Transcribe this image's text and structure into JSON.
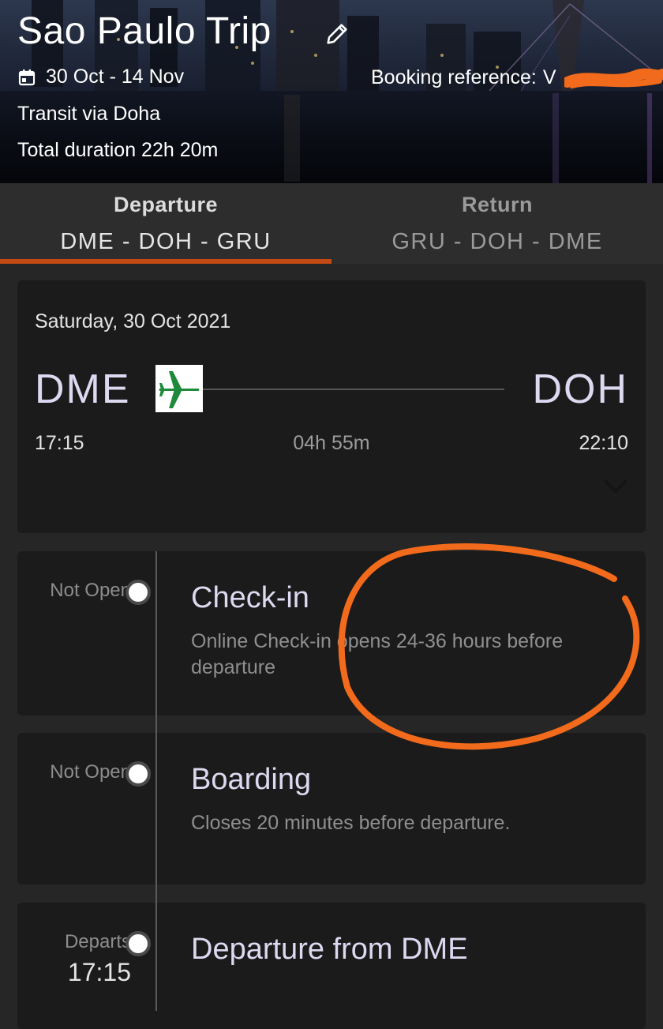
{
  "header": {
    "title": "Sao Paulo Trip",
    "dates": "30 Oct - 14 Nov",
    "booking_reference_label": "Booking reference:",
    "booking_reference_value": "V",
    "transit": "Transit via Doha",
    "total_duration": "Total duration 22h 20m"
  },
  "tabs": [
    {
      "label": "Departure",
      "route": "DME - DOH - GRU",
      "active": true
    },
    {
      "label": "Return",
      "route": "GRU - DOH - DME",
      "active": false
    }
  ],
  "flight": {
    "date": "Saturday, 30 Oct 2021",
    "origin": "DME",
    "destination": "DOH",
    "departure_time": "17:15",
    "duration": "04h 55m",
    "arrival_time": "22:10"
  },
  "timeline": {
    "checkin": {
      "status": "Not Open",
      "title": "Check-in",
      "description": "Online Check-in opens 24-36 hours before departure"
    },
    "boarding": {
      "status": "Not Open",
      "title": "Boarding",
      "description": "Closes 20 minutes before departure."
    },
    "departure": {
      "status": "Departs",
      "status_time": "17:15",
      "title": "Departure from DME"
    }
  },
  "colors": {
    "accent": "#c44a14",
    "annotation_circle": "#f26a1b",
    "plane_icon": "#1f8a3a",
    "background": "#262626",
    "card": "#1b1b1b"
  },
  "icons": {
    "edit": "pencil-icon",
    "calendar": "calendar-icon",
    "plane": "airplane-icon",
    "expand": "chevron-down-icon"
  }
}
